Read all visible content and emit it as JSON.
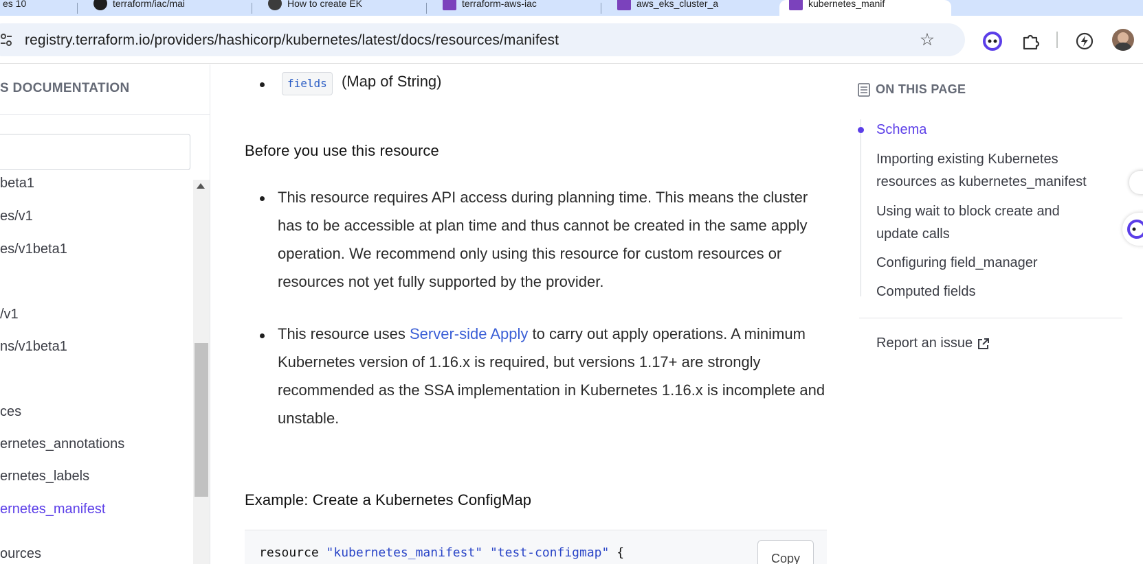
{
  "browser": {
    "tabs": [
      {
        "label": "es 10"
      },
      {
        "label": "terraform/iac/mai"
      },
      {
        "label": "How to create EK"
      },
      {
        "label": "terraform-aws-iac"
      },
      {
        "label": "aws_eks_cluster_a"
      },
      {
        "label": "kubernetes_manif"
      }
    ],
    "url": "registry.terraform.io/providers/hashicorp/kubernetes/latest/docs/resources/manifest",
    "icons": {
      "site_info": "site-info-icon",
      "bookmark": "star-icon",
      "assistant": "assistant-extension-icon",
      "extensions": "puzzle-icon",
      "performance": "performance-icon",
      "profile": "avatar"
    }
  },
  "sidebar": {
    "title": "S DOCUMENTATION",
    "items": [
      {
        "label": "beta1"
      },
      {
        "label": "es/v1"
      },
      {
        "label": "es/v1beta1"
      },
      {
        "label": "/v1"
      },
      {
        "label": "ns/v1beta1"
      },
      {
        "label": "ces"
      },
      {
        "label": "ernetes_annotations"
      },
      {
        "label": "ernetes_labels"
      },
      {
        "label": "ernetes_manifest",
        "active": true
      },
      {
        "label": "ources"
      }
    ]
  },
  "content": {
    "top_item": {
      "code": "fields",
      "text": "(Map of String)"
    },
    "before_heading": "Before you use this resource",
    "bullet1": "This resource requires API access during planning time. This means the cluster has to be accessible at plan time and thus cannot be created in the same apply operation. We recommend only using this resource for custom resources or resources not yet fully supported by the provider.",
    "bullet2": {
      "pre": "This resource uses ",
      "link": "Server-side Apply",
      "post": " to carry out apply operations. A minimum Kubernetes version of 1.16.x is required, but versions 1.17+ are strongly recommended as the SSA implementation in Kubernetes 1.16.x is incomplete and unstable."
    },
    "example_heading": "Example: Create a Kubernetes ConfigMap",
    "code": {
      "keyword": "resource ",
      "str1": "\"kubernetes_manifest\"",
      "str2": "\"test-configmap\"",
      "tail": " {"
    },
    "copy_label": "Copy"
  },
  "toc": {
    "heading": "ON THIS PAGE",
    "items": [
      {
        "label": "Schema",
        "active": true
      },
      {
        "label": "Importing existing Kubernetes resources as kubernetes_manifest"
      },
      {
        "label": "Using wait to block create and update calls"
      },
      {
        "label": "Configuring field_manager"
      },
      {
        "label": "Computed fields"
      }
    ],
    "report": "Report an issue"
  },
  "colors": {
    "accent": "#5b3ee8",
    "link": "#3b5fd6",
    "tabstrip": "#d3e3fd"
  }
}
